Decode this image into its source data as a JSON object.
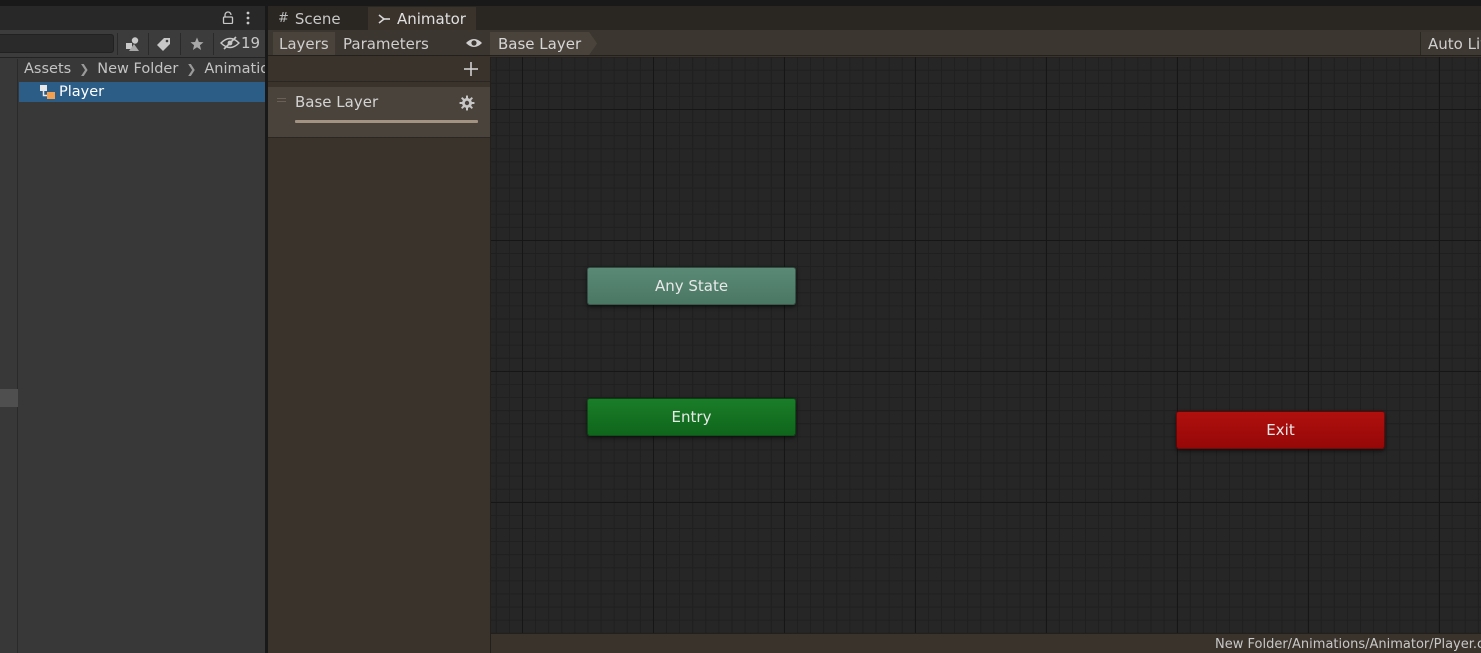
{
  "project_panel": {
    "hidden_count": "19",
    "breadcrumb": [
      "Assets",
      "New Folder",
      "Animation"
    ],
    "selected_asset": "Player",
    "selection_color": "#2c5d87"
  },
  "animator_window": {
    "tabs": [
      {
        "label": "Scene",
        "icon": "grid-icon"
      },
      {
        "label": "Animator",
        "icon": "animator-icon"
      }
    ],
    "toolbar": {
      "layers_tab": "Layers",
      "parameters_tab": "Parameters",
      "current_layer": "Base Layer",
      "auto_live": "Auto Liv"
    },
    "layers": [
      {
        "name": "Base Layer"
      }
    ],
    "graph": {
      "nodes": {
        "any_state": {
          "label": "Any State",
          "color": "#4f7d6a"
        },
        "entry": {
          "label": "Entry",
          "color": "#137322"
        },
        "exit": {
          "label": "Exit",
          "color": "#a00b09"
        }
      }
    },
    "status_path": "New Folder/Animations/Animator/Player.c"
  }
}
